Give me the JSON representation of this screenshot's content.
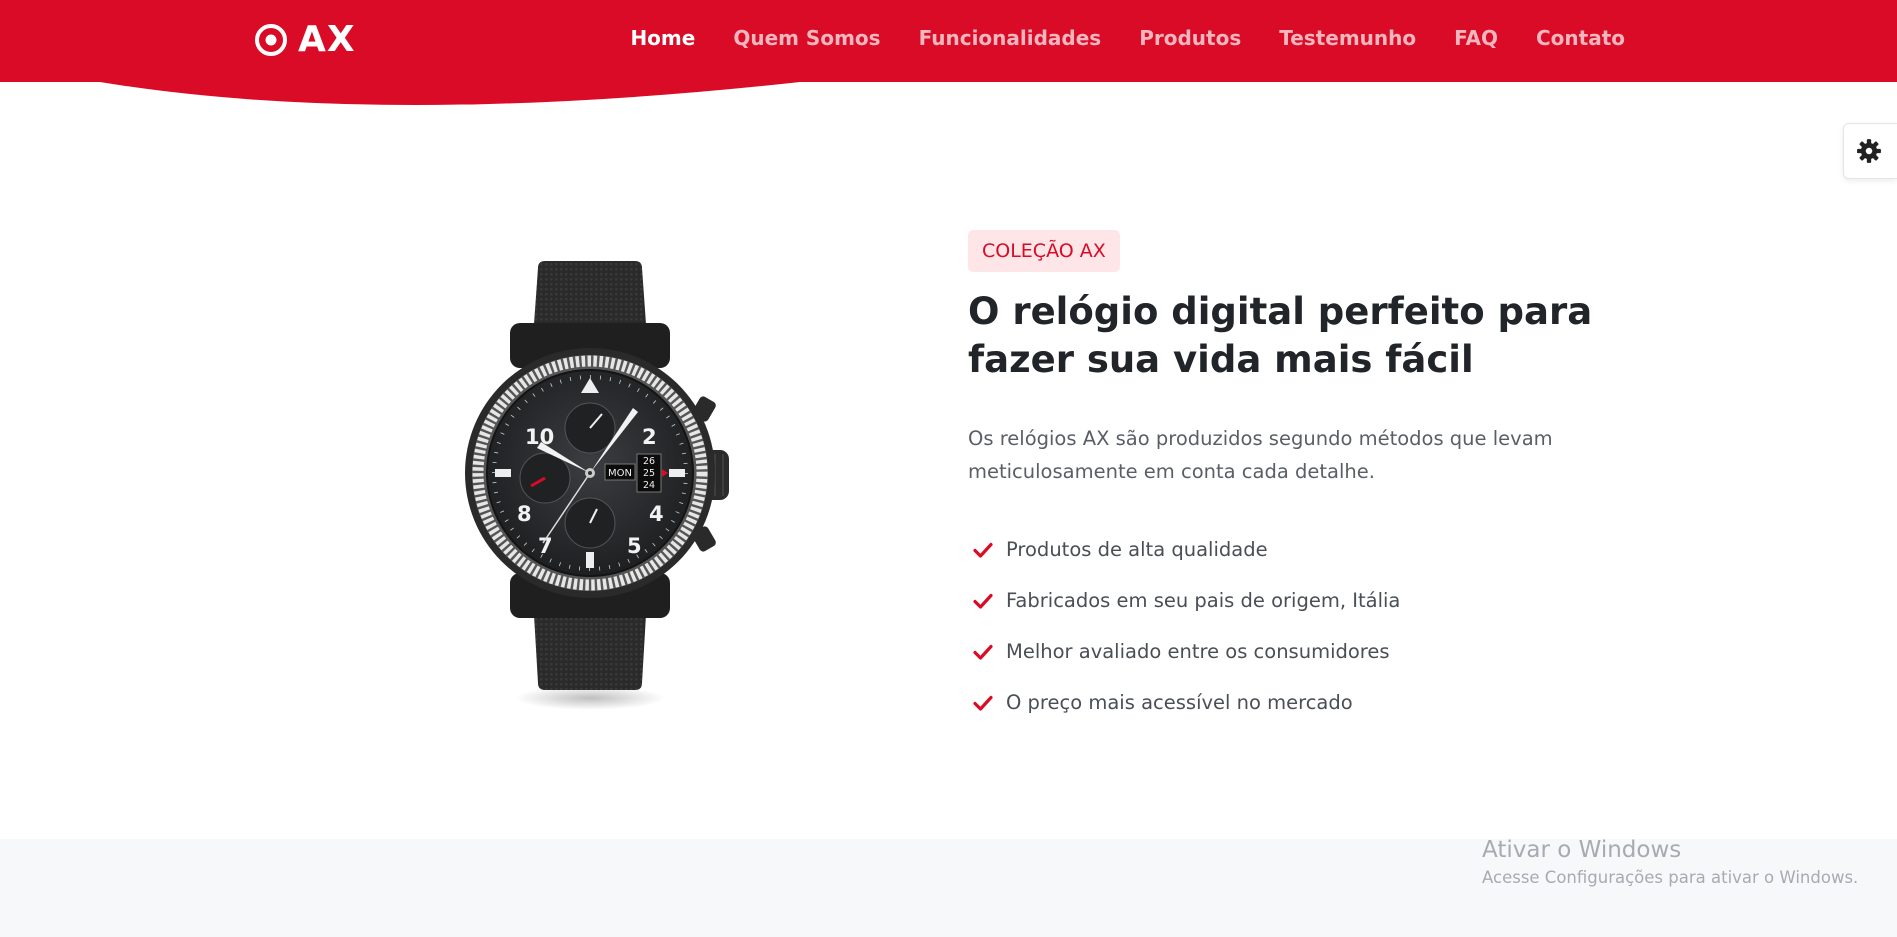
{
  "brand": {
    "name": "AX"
  },
  "nav": {
    "items": [
      {
        "label": "Home",
        "active": true
      },
      {
        "label": "Quem Somos",
        "active": false
      },
      {
        "label": "Funcionalidades",
        "active": false
      },
      {
        "label": "Produtos",
        "active": false
      },
      {
        "label": "Testemunho",
        "active": false
      },
      {
        "label": "FAQ",
        "active": false
      },
      {
        "label": "Contato",
        "active": false
      }
    ]
  },
  "settings": {
    "icon": "gear-icon"
  },
  "hero": {
    "badge": "COLEÇÃO AX",
    "headline": "O relógio digital perfeito para fazer sua vida mais fácil",
    "description": "Os relógios AX são produzidos segundo métodos que levam meticulosamente em conta cada detalhe.",
    "features": [
      "Produtos de alta qualidade",
      "Fabricados em seu pais de origem, Itália",
      "Melhor avaliado entre os consumidores",
      "O preço mais acessível no mercado"
    ],
    "feature_icon": "check-icon",
    "watch": {
      "numerals": [
        "10",
        "2",
        "8",
        "4",
        "7",
        "5"
      ],
      "day": "MON",
      "dates": [
        "26",
        "25",
        "24"
      ]
    }
  },
  "watermark": {
    "title": "Ativar o Windows",
    "subtitle": "Acesse Configurações para ativar o Windows."
  },
  "colors": {
    "brand_red": "#d90b26",
    "badge_bg": "#fde5e8",
    "heading": "#212529",
    "body_text": "#5a5f66",
    "footer_band": "#f7f8fa"
  }
}
